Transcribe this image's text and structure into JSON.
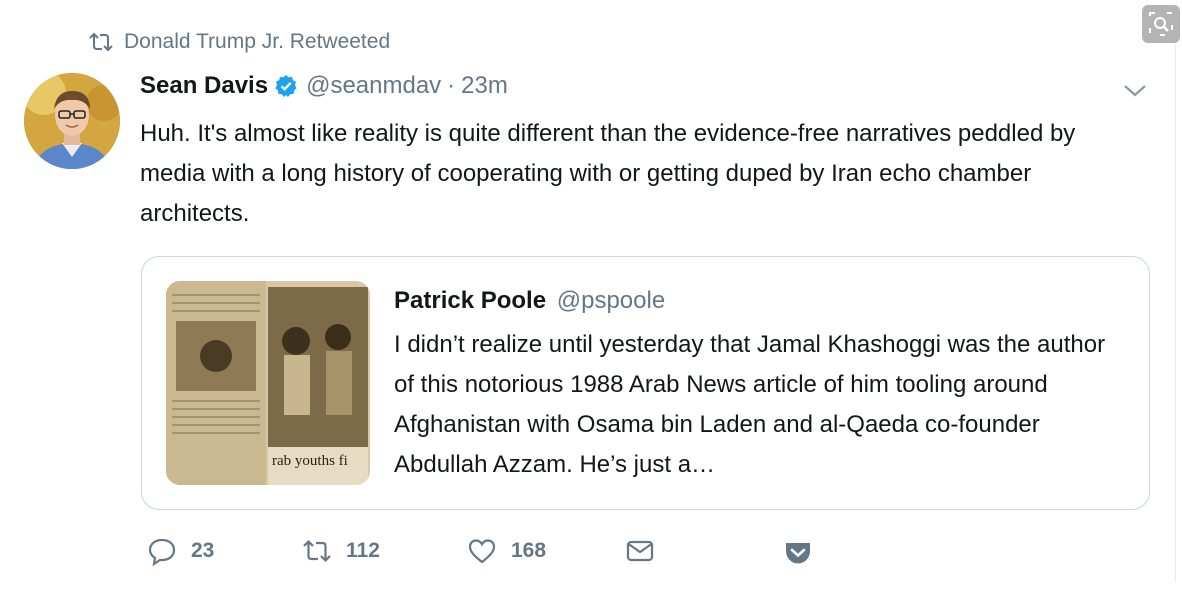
{
  "retweet": {
    "label": "Donald Trump Jr. Retweeted",
    "icon": "retweet-icon"
  },
  "tweet": {
    "author_name": "Sean Davis",
    "verified": true,
    "handle": "@seanmdav",
    "separator": "·",
    "time": "23m",
    "text": "Huh. It's almost like reality is quite different than the evidence-free narratives peddled by media with a long history of cooperating with or getting duped by Iran echo chamber architects."
  },
  "quoted": {
    "author_name": "Patrick Poole",
    "handle": "@pspoole",
    "text": "I didn’t realize until yesterday that Jamal Khashoggi was the author of this notorious 1988 Arab News article of him tooling around Afghanistan with Osama bin Laden and al-Qaeda co-founder Abdullah Azzam. He’s just a…",
    "image_caption": "rab youths fi"
  },
  "actions": {
    "reply_count": "23",
    "retweet_count": "112",
    "like_count": "168"
  },
  "colors": {
    "accent": "#1da1f2",
    "muted": "#657786",
    "text": "#14171a",
    "border": "#ccd6dd"
  },
  "icons": [
    "retweet-icon",
    "verified-icon",
    "chevron-down-icon",
    "reply-icon",
    "like-icon",
    "mail-icon",
    "pocket-icon",
    "search-icon"
  ]
}
